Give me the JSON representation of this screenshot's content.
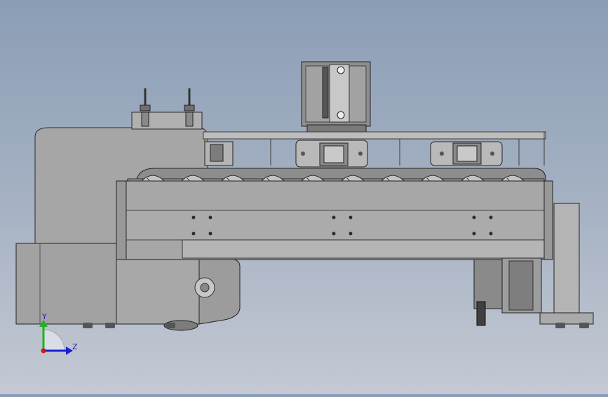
{
  "viewport": {
    "background_top": "#8b9db6",
    "background_bottom": "#c4c9d3"
  },
  "triad": {
    "y_label": "Y",
    "z_label": "Z",
    "y_color": "#1db51d",
    "z_color": "#1a1fd6",
    "origin_color": "#d01818"
  },
  "model": {
    "body_color": "#a5a5a5",
    "dark_color": "#6e6e6e",
    "edge_color": "#2a2a2a",
    "motor_color": "#8c8c8c"
  }
}
